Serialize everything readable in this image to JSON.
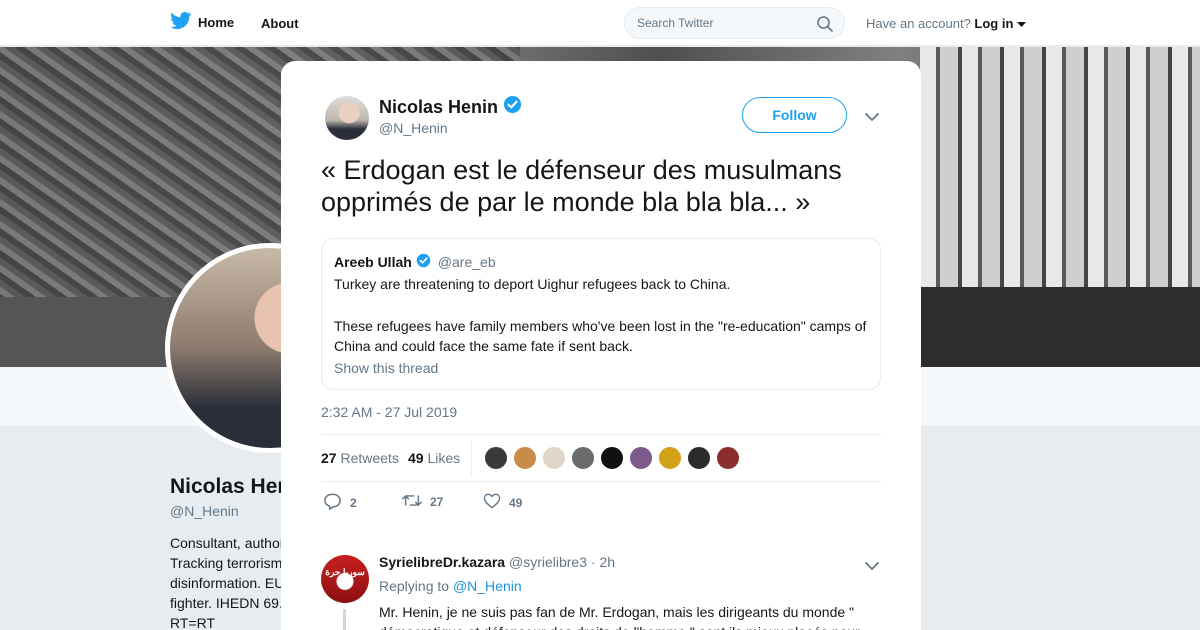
{
  "nav": {
    "home_label": "Home",
    "about_label": "About",
    "search_placeholder": "Search Twitter",
    "account_prompt": "Have an account?",
    "login_label": "Log in"
  },
  "background_profile": {
    "name": "Nicolas Hen",
    "handle": "@N_Henin",
    "bio_lines": [
      "Consultant, author",
      "Tracking terrorism",
      "disinformation. EU",
      "fighter. IHEDN 69.",
      "RT=RT"
    ]
  },
  "tweet": {
    "author_name": "Nicolas Henin",
    "author_handle": "@N_Henin",
    "follow_label": "Follow",
    "text": "« Erdogan est le défenseur des musulmans opprimés de par le monde bla bla bla... »",
    "timestamp": "2:32 AM - 27 Jul 2019",
    "retweets_count": "27",
    "retweets_label": "Retweets",
    "likes_count": "49",
    "likes_label": "Likes",
    "action_replies": "2",
    "action_retweets": "27",
    "action_likes": "49",
    "quoted": {
      "name": "Areeb Ullah",
      "handle": "@are_eb",
      "line1": "Turkey are threatening to deport Uighur refugees back to China.",
      "line2": "These refugees have family members who've been lost in the \"re-education\" camps of China and could face the same fate if sent back.",
      "show_thread": "Show this thread"
    },
    "liker_colors": [
      "#3a3a3a",
      "#c98b4a",
      "#e0d6c8",
      "#6b6b6b",
      "#111111",
      "#7d5a8c",
      "#d4a017",
      "#2b2b2b",
      "#8b2e2e"
    ]
  },
  "reply": {
    "name": "SyrielibreDr.kazara",
    "handle": "@syrielibre3",
    "time": "· 2h",
    "replying_prefix": "Replying to",
    "replying_mention": "@N_Henin",
    "avatar_text": "سوريا حرة",
    "text": "Mr. Henin, je ne suis pas fan de Mr. Erdogan, mais les dirigeants du monde \" démocratique et défenseur des droits de l'homme \" sont ils mieux placés pour"
  },
  "colors": {
    "twitter_blue": "#1da1f2",
    "verified": "#1da1f2",
    "muted": "#657786"
  }
}
